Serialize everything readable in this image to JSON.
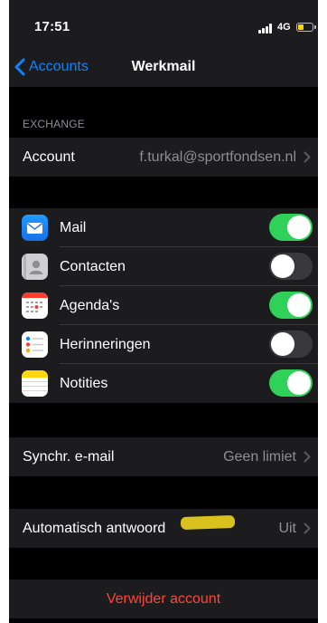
{
  "status_bar": {
    "time": "17:51",
    "network": "4G",
    "battery_level": 0.4
  },
  "nav": {
    "back_label": "Accounts",
    "title": "Werkmail"
  },
  "exchange": {
    "header": "EXCHANGE",
    "account_label": "Account",
    "account_value": "f.turkal@sportfondsen.nl"
  },
  "sync_items": [
    {
      "label": "Mail",
      "icon": "mail-icon",
      "on": true
    },
    {
      "label": "Contacten",
      "icon": "contacts-icon",
      "on": false
    },
    {
      "label": "Agenda's",
      "icon": "calendar-icon",
      "on": true
    },
    {
      "label": "Herinneringen",
      "icon": "reminders-icon",
      "on": false
    },
    {
      "label": "Notities",
      "icon": "notes-icon",
      "on": true
    }
  ],
  "sync_mail": {
    "label": "Synchr. e-mail",
    "value": "Geen limiet"
  },
  "auto_reply": {
    "label": "Automatisch antwoord",
    "value": "Uit"
  },
  "delete_account": {
    "label": "Verwijder account"
  },
  "colors": {
    "background": "#000000",
    "cell": "#1c1c1e",
    "accent": "#0a84ff",
    "toggle_on": "#30d158",
    "destructive": "#ff453a",
    "secondary_text": "#8e8e93",
    "redaction": "#d9c21d"
  }
}
